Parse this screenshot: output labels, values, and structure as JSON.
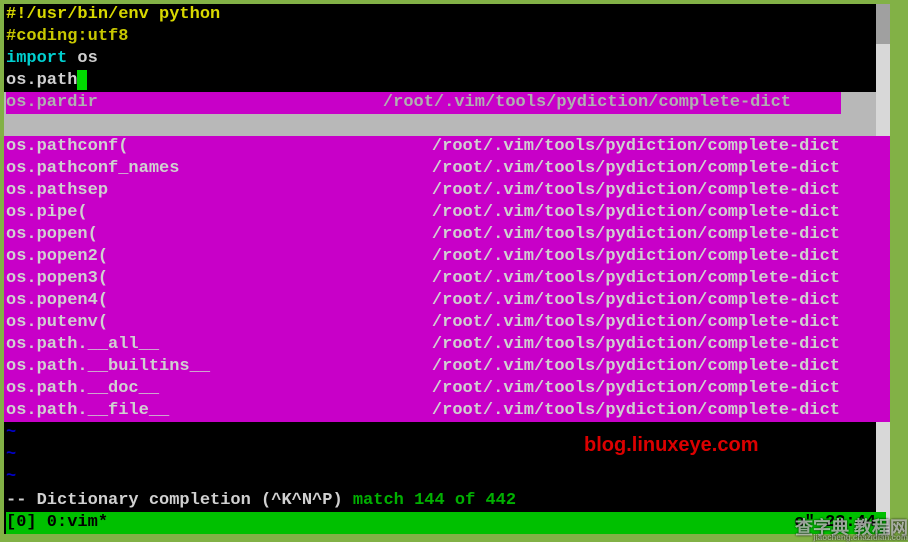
{
  "code": {
    "shebang": "#!/usr/bin/env python",
    "coding": "#coding:utf8",
    "import_kw": "import",
    "import_mod": " os",
    "typed_prefix": "os.path"
  },
  "popup": {
    "selected": {
      "name": "os.pardir",
      "src": "/root/.vim/tools/pydiction/complete-dict"
    },
    "items": [
      {
        "name": "os.pathconf(",
        "src": "/root/.vim/tools/pydiction/complete-dict"
      },
      {
        "name": "os.pathconf_names",
        "src": "/root/.vim/tools/pydiction/complete-dict"
      },
      {
        "name": "os.pathsep",
        "src": "/root/.vim/tools/pydiction/complete-dict"
      },
      {
        "name": "os.pipe(",
        "src": "/root/.vim/tools/pydiction/complete-dict"
      },
      {
        "name": "os.popen(",
        "src": "/root/.vim/tools/pydiction/complete-dict"
      },
      {
        "name": "os.popen2(",
        "src": "/root/.vim/tools/pydiction/complete-dict"
      },
      {
        "name": "os.popen3(",
        "src": "/root/.vim/tools/pydiction/complete-dict"
      },
      {
        "name": "os.popen4(",
        "src": "/root/.vim/tools/pydiction/complete-dict"
      },
      {
        "name": "os.putenv(",
        "src": "/root/.vim/tools/pydiction/complete-dict"
      },
      {
        "name": "os.path.__all__",
        "src": "/root/.vim/tools/pydiction/complete-dict"
      },
      {
        "name": "os.path.__builtins__",
        "src": "/root/.vim/tools/pydiction/complete-dict"
      },
      {
        "name": "os.path.__doc__",
        "src": "/root/.vim/tools/pydiction/complete-dict"
      },
      {
        "name": "os.path.__file__",
        "src": "/root/.vim/tools/pydiction/complete-dict"
      }
    ]
  },
  "tilde": "~",
  "status": {
    "mode": "-- Dictionary completion (^K^N^P) ",
    "match": "match 144 of 442"
  },
  "tmux": {
    "left": "[0] 0:vim*",
    "right": "o\" 23:44"
  },
  "watermarks": {
    "url": "blog.linuxeye.com",
    "cn_main": "查字典 教程网",
    "cn_sub": "jiaocheng.chazidian.com"
  }
}
